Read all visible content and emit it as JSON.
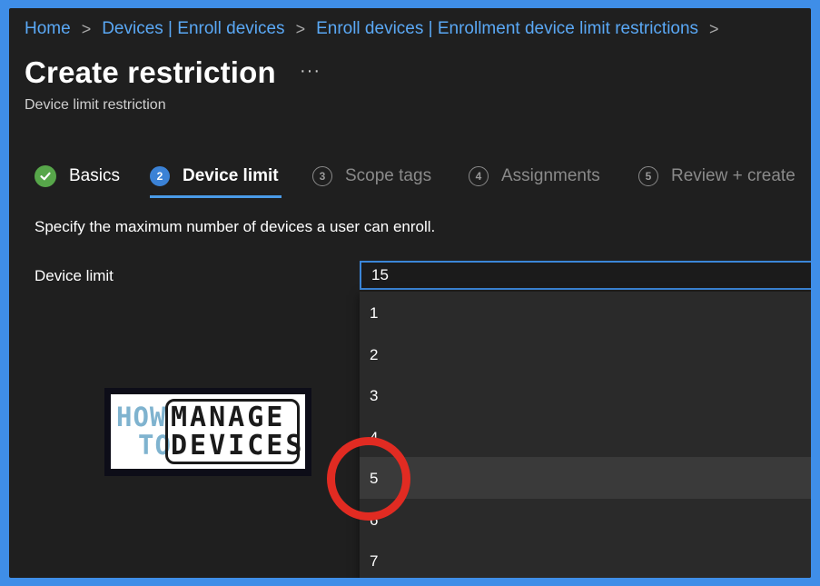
{
  "breadcrumb": {
    "items": [
      "Home",
      "Devices | Enroll devices",
      "Enroll devices | Enrollment device limit restrictions"
    ],
    "separator": ">"
  },
  "header": {
    "title": "Create restriction",
    "more_label": "···",
    "subtitle": "Device limit restriction"
  },
  "tabs": [
    {
      "number": "",
      "label": "Basics",
      "state": "completed"
    },
    {
      "number": "2",
      "label": "Device limit",
      "state": "active"
    },
    {
      "number": "3",
      "label": "Scope tags",
      "state": "pending"
    },
    {
      "number": "4",
      "label": "Assignments",
      "state": "pending"
    },
    {
      "number": "5",
      "label": "Review + create",
      "state": "pending"
    }
  ],
  "main": {
    "instruction": "Specify the maximum number of devices a user can enroll.",
    "device_limit_label": "Device limit",
    "device_limit_value": "15",
    "options": [
      "1",
      "2",
      "3",
      "4",
      "5",
      "6",
      "7"
    ],
    "hovered_option": "5"
  },
  "logo": {
    "line1_left": "HOW",
    "line1_right": "MANAGE",
    "line2_left": "TO",
    "line2_right": "DEVICES"
  },
  "colors": {
    "accent": "#3b86d8",
    "link": "#5aa8f5",
    "success": "#57a64a",
    "highlight": "#e12b22",
    "background": "#1f1f1f",
    "outer_border": "#3f8ee8"
  },
  "icons": {
    "basics_tab": "check-circle-icon",
    "breadcrumb_separator": "chevron-right-icon",
    "more": "ellipsis-icon"
  }
}
